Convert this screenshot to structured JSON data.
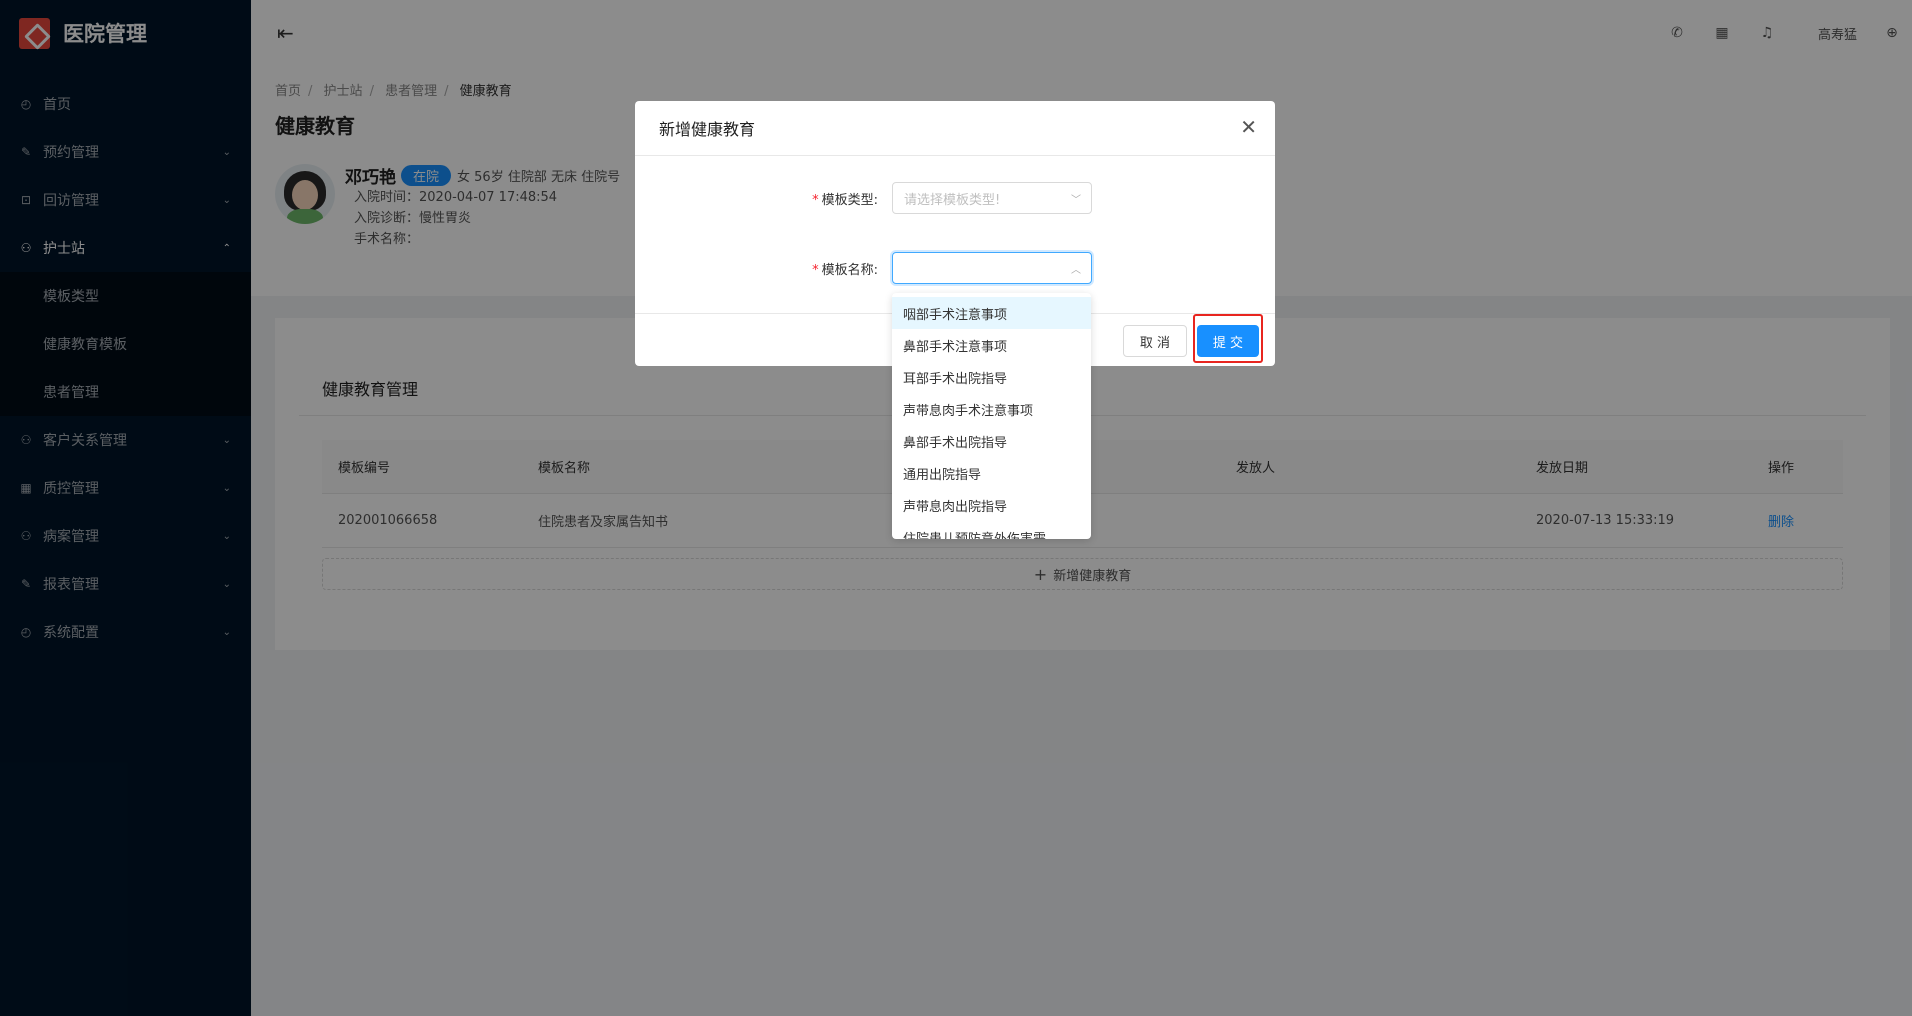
{
  "app": {
    "title": "医院管理"
  },
  "sidebar": {
    "items": [
      {
        "label": "首页",
        "icon": "dashboard-icon"
      },
      {
        "label": "预约管理",
        "icon": "edit-icon"
      },
      {
        "label": "回访管理",
        "icon": "lock-icon"
      },
      {
        "label": "护士站",
        "icon": "team-icon"
      },
      {
        "label": "客户关系管理",
        "icon": "team-icon"
      },
      {
        "label": "质控管理",
        "icon": "table-icon"
      },
      {
        "label": "病案管理",
        "icon": "team-icon"
      },
      {
        "label": "报表管理",
        "icon": "edit-icon"
      },
      {
        "label": "系统配置",
        "icon": "dashboard-icon"
      }
    ],
    "nurse_submenu": [
      "模板类型",
      "健康教育模板",
      "患者管理"
    ]
  },
  "header": {
    "user_name": "高寿猛",
    "icons": [
      "phone-icon",
      "appstore-icon",
      "bell-icon",
      "global-icon"
    ]
  },
  "breadcrumb": [
    "首页",
    "护士站",
    "患者管理",
    "健康教育"
  ],
  "page_title": "健康教育",
  "patient": {
    "name": "邓巧艳",
    "status": "在院",
    "tags": "女 56岁 住院部  无床  住院号",
    "admit_time": "入院时间：2020-04-07 17:48:54",
    "diagnosis": "入院诊断：慢性胃炎",
    "surgery": "手术名称："
  },
  "card": {
    "title": "健康教育管理",
    "columns": [
      "模板编号",
      "模板名称",
      "发放人",
      "发放日期",
      "操作"
    ],
    "rows": [
      {
        "code": "202001066658",
        "name": "住院患者及家属告知书",
        "issuer": "",
        "date": "2020-07-13 15:33:19",
        "action": "删除"
      }
    ],
    "add_label": "新增健康教育"
  },
  "modal": {
    "title": "新增健康教育",
    "type_label": "模板类型:",
    "type_placeholder": "请选择模板类型!",
    "name_label": "模板名称:",
    "cancel_label": "取 消",
    "submit_label": "提 交"
  },
  "dropdown": {
    "options": [
      "咽部手术注意事项",
      "鼻部手术注意事项",
      "耳部手术出院指导",
      "声带息肉手术注意事项",
      "鼻部手术出院指导",
      "通用出院指导",
      "声带息肉出院指导",
      "住院患儿预防意外伤害需..."
    ]
  },
  "colors": {
    "sidebar_bg": "#001529",
    "primary": "#1890ff",
    "logo": "#e8473c",
    "highlight": "#e8251f"
  }
}
